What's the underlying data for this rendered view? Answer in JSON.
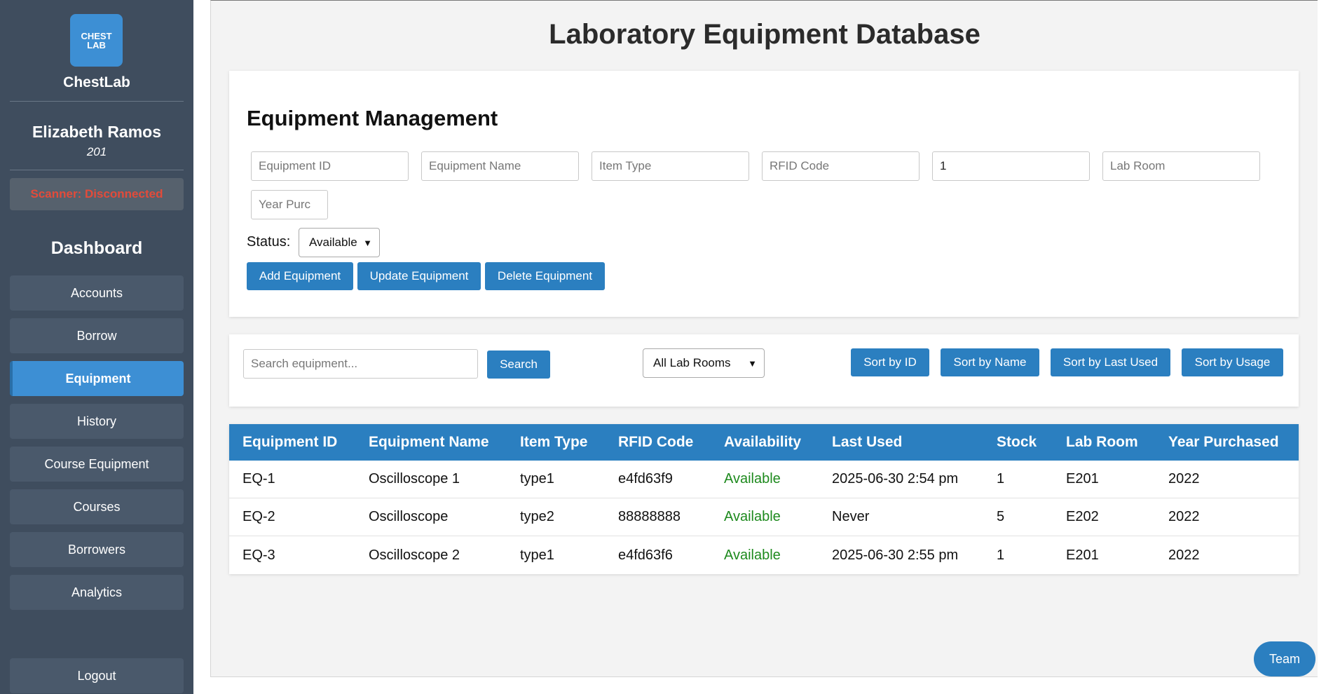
{
  "sidebar": {
    "logo_text_line1": "CHEST",
    "logo_text_line2": "LAB",
    "brand": "ChestLab",
    "user_name": "Elizabeth Ramos",
    "user_id": "201",
    "scanner_status": "Scanner: Disconnected",
    "dashboard_title": "Dashboard",
    "nav_items": [
      {
        "label": "Accounts",
        "active": false
      },
      {
        "label": "Borrow",
        "active": false
      },
      {
        "label": "Equipment",
        "active": true
      },
      {
        "label": "History",
        "active": false
      },
      {
        "label": "Course Equipment",
        "active": false
      },
      {
        "label": "Courses",
        "active": false
      },
      {
        "label": "Borrowers",
        "active": false
      },
      {
        "label": "Analytics",
        "active": false
      }
    ],
    "logout_label": "Logout"
  },
  "main": {
    "title": "Laboratory Equipment Database",
    "management": {
      "title": "Equipment Management",
      "fields": {
        "equipment_id": {
          "placeholder": "Equipment ID",
          "value": ""
        },
        "equipment_name": {
          "placeholder": "Equipment Name",
          "value": ""
        },
        "item_type": {
          "placeholder": "Item Type",
          "value": ""
        },
        "rfid_code": {
          "placeholder": "RFID Code",
          "value": ""
        },
        "stock": {
          "placeholder": "",
          "value": "1"
        },
        "lab_room": {
          "placeholder": "Lab Room",
          "value": ""
        },
        "year_purchased": {
          "placeholder": "Year Purc",
          "value": ""
        }
      },
      "status_label": "Status:",
      "status_value": "Available",
      "buttons": {
        "add": "Add Equipment",
        "update": "Update Equipment",
        "delete": "Delete Equipment"
      }
    },
    "search": {
      "placeholder": "Search equipment...",
      "button": "Search",
      "room_filter": "All Lab Rooms",
      "sort_buttons": {
        "by_id": "Sort by ID",
        "by_name": "Sort by Name",
        "by_last_used": "Sort by Last Used",
        "by_usage": "Sort by Usage"
      }
    },
    "table": {
      "headers": [
        "Equipment ID",
        "Equipment Name",
        "Item Type",
        "RFID Code",
        "Availability",
        "Last Used",
        "Stock",
        "Lab Room",
        "Year Purchased"
      ],
      "rows": [
        [
          "EQ-1",
          "Oscilloscope 1",
          "type1",
          "e4fd63f9",
          "Available",
          "2025-06-30 2:54 pm",
          "1",
          "E201",
          "2022"
        ],
        [
          "EQ-2",
          "Oscilloscope",
          "type2",
          "88888888",
          "Available",
          "Never",
          "5",
          "E202",
          "2022"
        ],
        [
          "EQ-3",
          "Oscilloscope 2",
          "type1",
          "e4fd63f6",
          "Available",
          "2025-06-30 2:55 pm",
          "1",
          "E201",
          "2022"
        ]
      ],
      "availability_color": "#1e8a1e"
    },
    "team_button": "Team"
  },
  "colors": {
    "sidebar_bg": "#3f4d5e",
    "accent": "#2b7fc0",
    "scanner_disconnected": "#e34b3a"
  }
}
